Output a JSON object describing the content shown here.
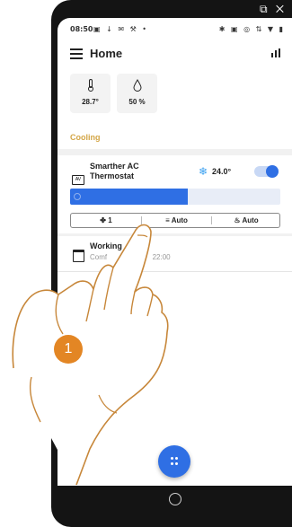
{
  "status_bar": {
    "time": "08:50",
    "left_icons": "▣ ↓ ✉ ⚒ •",
    "right_icons": "✱ ▣ ◎ ⇅ ▼ ▮"
  },
  "app_bar": {
    "title": "Home",
    "menu_icon": "hamburger-icon",
    "stats_icon": "bar-chart-icon"
  },
  "sensors": [
    {
      "icon": "thermometer-icon",
      "value": "28.7°"
    },
    {
      "icon": "humidity-drop-icon",
      "value": "50 %"
    }
  ],
  "section_label": "Cooling",
  "device": {
    "name": "Smarther AC Thermostat",
    "mode_icon": "snowflake-icon",
    "setpoint": "24.0°",
    "power_on": true,
    "slider_fraction": 0.56
  },
  "controls": {
    "fan_speed": "1",
    "swing": "Auto",
    "mode": "Auto"
  },
  "schedule": {
    "title": "Working",
    "subtitle_start": "Comf",
    "subtitle_end": "22:00"
  },
  "fab_icon": "dots-grid-icon",
  "step_badge": "1",
  "colors": {
    "accent": "#2f6fe4",
    "section": "#d4a646",
    "badge": "#e38624"
  }
}
